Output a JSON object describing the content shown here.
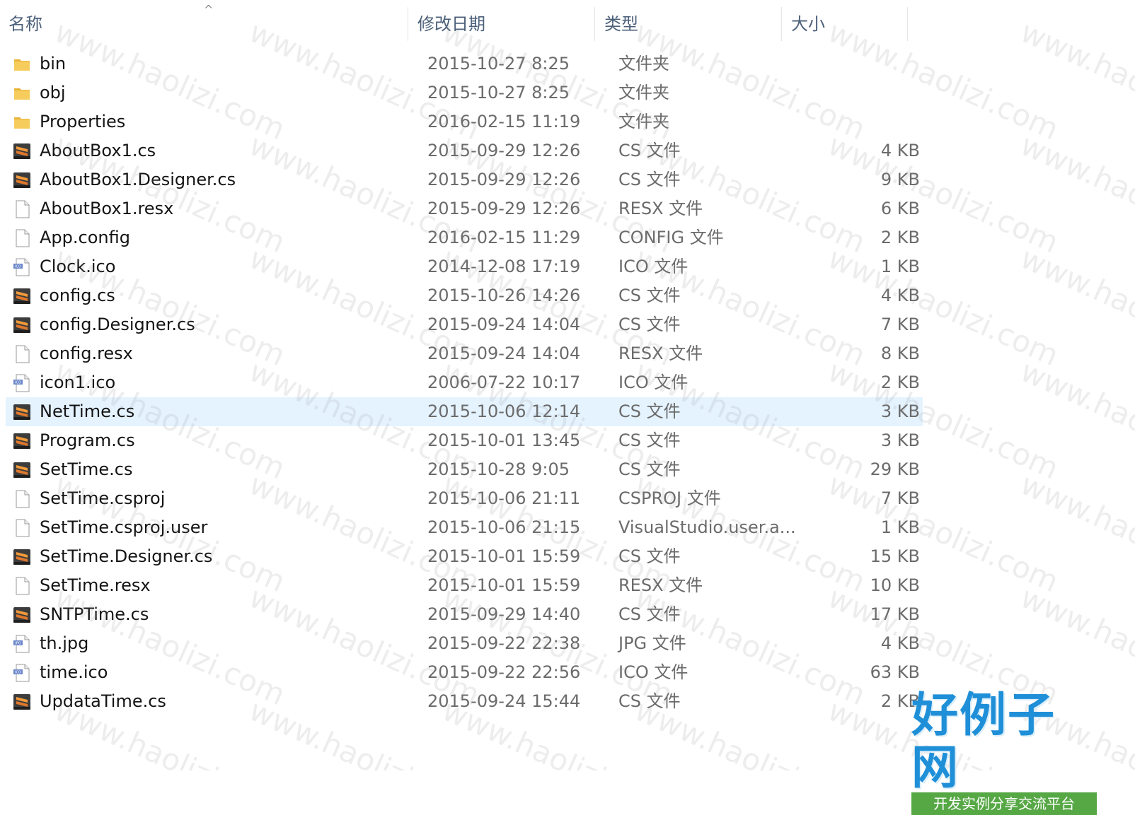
{
  "columns": {
    "name": "名称",
    "date": "修改日期",
    "type": "类型",
    "size": "大小"
  },
  "sort_indicator": "^",
  "files": [
    {
      "icon": "folder-icon",
      "name": "bin",
      "date": "2015-10-27 8:25",
      "type": "文件夹",
      "size": ""
    },
    {
      "icon": "folder-icon",
      "name": "obj",
      "date": "2015-10-27 8:25",
      "type": "文件夹",
      "size": ""
    },
    {
      "icon": "folder-icon",
      "name": "Properties",
      "date": "2016-02-15 11:19",
      "type": "文件夹",
      "size": ""
    },
    {
      "icon": "sublime-cs-file-icon",
      "name": "AboutBox1.cs",
      "date": "2015-09-29 12:26",
      "type": "CS 文件",
      "size": "4 KB"
    },
    {
      "icon": "sublime-cs-file-icon",
      "name": "AboutBox1.Designer.cs",
      "date": "2015-09-29 12:26",
      "type": "CS 文件",
      "size": "9 KB"
    },
    {
      "icon": "blank-file-icon",
      "name": "AboutBox1.resx",
      "date": "2015-09-29 12:26",
      "type": "RESX 文件",
      "size": "6 KB"
    },
    {
      "icon": "blank-file-icon",
      "name": "App.config",
      "date": "2016-02-15 11:29",
      "type": "CONFIG 文件",
      "size": "2 KB"
    },
    {
      "icon": "ico-file-icon",
      "name": "Clock.ico",
      "date": "2014-12-08 17:19",
      "type": "ICO 文件",
      "size": "1 KB"
    },
    {
      "icon": "sublime-cs-file-icon",
      "name": "config.cs",
      "date": "2015-10-26 14:26",
      "type": "CS 文件",
      "size": "4 KB"
    },
    {
      "icon": "sublime-cs-file-icon",
      "name": "config.Designer.cs",
      "date": "2015-09-24 14:04",
      "type": "CS 文件",
      "size": "7 KB"
    },
    {
      "icon": "blank-file-icon",
      "name": "config.resx",
      "date": "2015-09-24 14:04",
      "type": "RESX 文件",
      "size": "8 KB"
    },
    {
      "icon": "ico-file-icon",
      "name": "icon1.ico",
      "date": "2006-07-22 10:17",
      "type": "ICO 文件",
      "size": "2 KB"
    },
    {
      "icon": "sublime-cs-file-icon",
      "name": "NetTime.cs",
      "date": "2015-10-06 12:14",
      "type": "CS 文件",
      "size": "3 KB",
      "selected": true
    },
    {
      "icon": "sublime-cs-file-icon",
      "name": "Program.cs",
      "date": "2015-10-01 13:45",
      "type": "CS 文件",
      "size": "3 KB"
    },
    {
      "icon": "sublime-cs-file-icon",
      "name": "SetTime.cs",
      "date": "2015-10-28 9:05",
      "type": "CS 文件",
      "size": "29 KB"
    },
    {
      "icon": "blank-file-icon",
      "name": "SetTime.csproj",
      "date": "2015-10-06 21:11",
      "type": "CSPROJ 文件",
      "size": "7 KB"
    },
    {
      "icon": "blank-file-icon",
      "name": "SetTime.csproj.user",
      "date": "2015-10-06 21:15",
      "type": "VisualStudio.user.a...",
      "size": "1 KB"
    },
    {
      "icon": "sublime-cs-file-icon",
      "name": "SetTime.Designer.cs",
      "date": "2015-10-01 15:59",
      "type": "CS 文件",
      "size": "15 KB"
    },
    {
      "icon": "blank-file-icon",
      "name": "SetTime.resx",
      "date": "2015-10-01 15:59",
      "type": "RESX 文件",
      "size": "10 KB"
    },
    {
      "icon": "sublime-cs-file-icon",
      "name": "SNTPTime.cs",
      "date": "2015-09-29 14:40",
      "type": "CS 文件",
      "size": "17 KB"
    },
    {
      "icon": "jpg-file-icon",
      "name": "th.jpg",
      "date": "2015-09-22 22:38",
      "type": "JPG 文件",
      "size": "4 KB"
    },
    {
      "icon": "ico-file-icon",
      "name": "time.ico",
      "date": "2015-09-22 22:56",
      "type": "ICO 文件",
      "size": "63 KB"
    },
    {
      "icon": "sublime-cs-file-icon",
      "name": "UpdataTime.cs",
      "date": "2015-09-24 15:44",
      "type": "CS 文件",
      "size": "2 KB"
    }
  ],
  "watermark": {
    "text": "www.haolizi.com"
  },
  "logo": {
    "main": "好例子网",
    "sub": "开发实例分享交流平台"
  },
  "colors": {
    "header_text": "#4c607a",
    "selected_row": "#e5f3ff",
    "folder": "#f2c14e",
    "sublime_icon": "#e0782b",
    "logo_blue": "#1f8fd8",
    "logo_green": "#56a845"
  }
}
